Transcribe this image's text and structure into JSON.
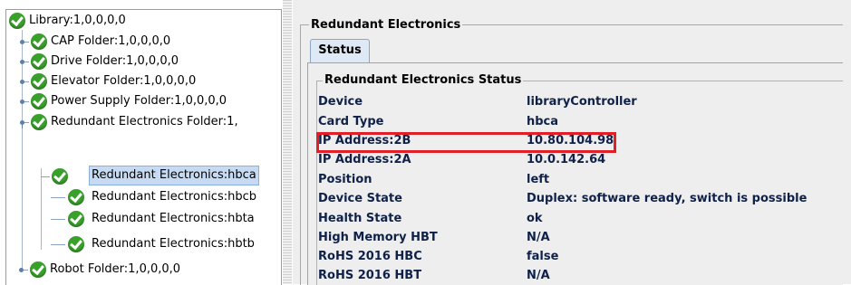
{
  "tree": {
    "root": {
      "label": "Library:1,0,0,0,0"
    },
    "folders": [
      {
        "label": "CAP Folder:1,0,0,0,0"
      },
      {
        "label": "Drive Folder:1,0,0,0,0"
      },
      {
        "label": "Elevator Folder:1,0,0,0,0"
      },
      {
        "label": "Power Supply Folder:1,0,0,0,0"
      },
      {
        "label": "Redundant Electronics Folder:1,"
      }
    ],
    "children": [
      {
        "label": "Redundant Electronics:hbca",
        "selected": true
      },
      {
        "label": "Redundant Electronics:hbcb"
      },
      {
        "label": "Redundant Electronics:hbta"
      },
      {
        "label": "Redundant Electronics:hbtb"
      }
    ],
    "last_folder": {
      "label": "Robot Folder:1,0,0,0,0"
    }
  },
  "panel": {
    "title": "Redundant Electronics",
    "tab_label": "Status",
    "status_title": "Redundant Electronics Status",
    "rows": [
      {
        "key": "Device",
        "value": "libraryController"
      },
      {
        "key": "Card Type",
        "value": "hbca"
      },
      {
        "key": "IP Address:2B",
        "value": "10.80.104.98"
      },
      {
        "key": "IP Address:2A",
        "value": "10.0.142.64"
      },
      {
        "key": "Position",
        "value": "left"
      },
      {
        "key": "Device State",
        "value": "Duplex: software ready, switch is possible"
      },
      {
        "key": "Health State",
        "value": "ok"
      },
      {
        "key": "High Memory HBT",
        "value": "N/A"
      },
      {
        "key": "RoHS 2016 HBC",
        "value": "false"
      },
      {
        "key": "RoHS 2016 HBT",
        "value": "N/A"
      }
    ]
  },
  "colors": {
    "status_ok": "#3aa02c",
    "highlight": "#e01f26",
    "selection": "#c6dbf3"
  },
  "icons": {
    "status": "check-circle-icon",
    "tree_handle": "tree-toggle-icon"
  }
}
